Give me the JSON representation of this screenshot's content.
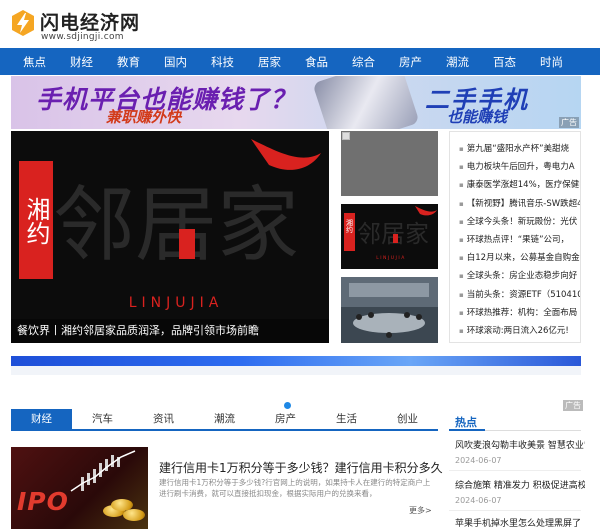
{
  "site": {
    "name": "闪电经济网",
    "url": "www.sdjingji.com"
  },
  "nav": [
    "焦点",
    "财经",
    "教育",
    "国内",
    "科技",
    "居家",
    "食品",
    "综合",
    "房产",
    "潮流",
    "百态",
    "时尚"
  ],
  "banner_top": {
    "left_main": "手机平台也能赚钱了？",
    "left_sub": "兼职赚外快",
    "right_main": "二手手机",
    "right_sub": "也能赚钱",
    "ad_label": "广告"
  },
  "hero": {
    "caption": "餐饮界丨湘约邻居家品质润泽，品牌引领市场前瞻",
    "art_left": "湘约",
    "art_main": "邻居家",
    "art_sub": "LINJUJIA"
  },
  "thumb2_art": {
    "left": "湘约",
    "main": "邻居家",
    "sub": "LINJUJIA"
  },
  "news_list": [
    "第九届“盛阳水产杯”美甜烧",
    "电力板块午后回升，粤电力A",
    "康泰医学涨超14%，医疗保健E",
    "【新视野】腾讯音乐-SW跌超4",
    "全球今头条！新玩殿份：光伏",
    "环球热点评！“果链”公司，",
    "白12月以来，公募基金自购金",
    "全球头条：房企业态稳步向好",
    "当前头条：资源ETF（510410",
    "环球热推荐：机构：全面布局",
    "环球滚动:两日流入26亿元!"
  ],
  "banner_second_ad_label": "广告",
  "tabs": [
    "财经",
    "汽车",
    "资讯",
    "潮流",
    "房产",
    "生活",
    "创业"
  ],
  "article": {
    "title": "建行信用卡1万积分等于多少钱？建行信用卡积分多久",
    "desc": "建行信用卡1万积分等于多少钱?行官网上的说明，如果持卡人在建行的特定商户上进行刷卡消费，就可以直接抵扣现金，根据实际用户的兑换来看，",
    "image_text": "IPO",
    "more": "更多>"
  },
  "hot": {
    "title": "热点",
    "items": [
      {
        "title": "风吹麦浪勾勒丰收美景 智慧农业'",
        "date": "2024-06-07"
      },
      {
        "title": "综合施策 精准发力 积极促进高校",
        "date": "2024-06-07"
      },
      {
        "title": "苹果手机掉水里怎么处理黑屏了"
      }
    ]
  },
  "colors": {
    "brand_blue": "#1565c0",
    "logo_orange": "#f5a623"
  }
}
